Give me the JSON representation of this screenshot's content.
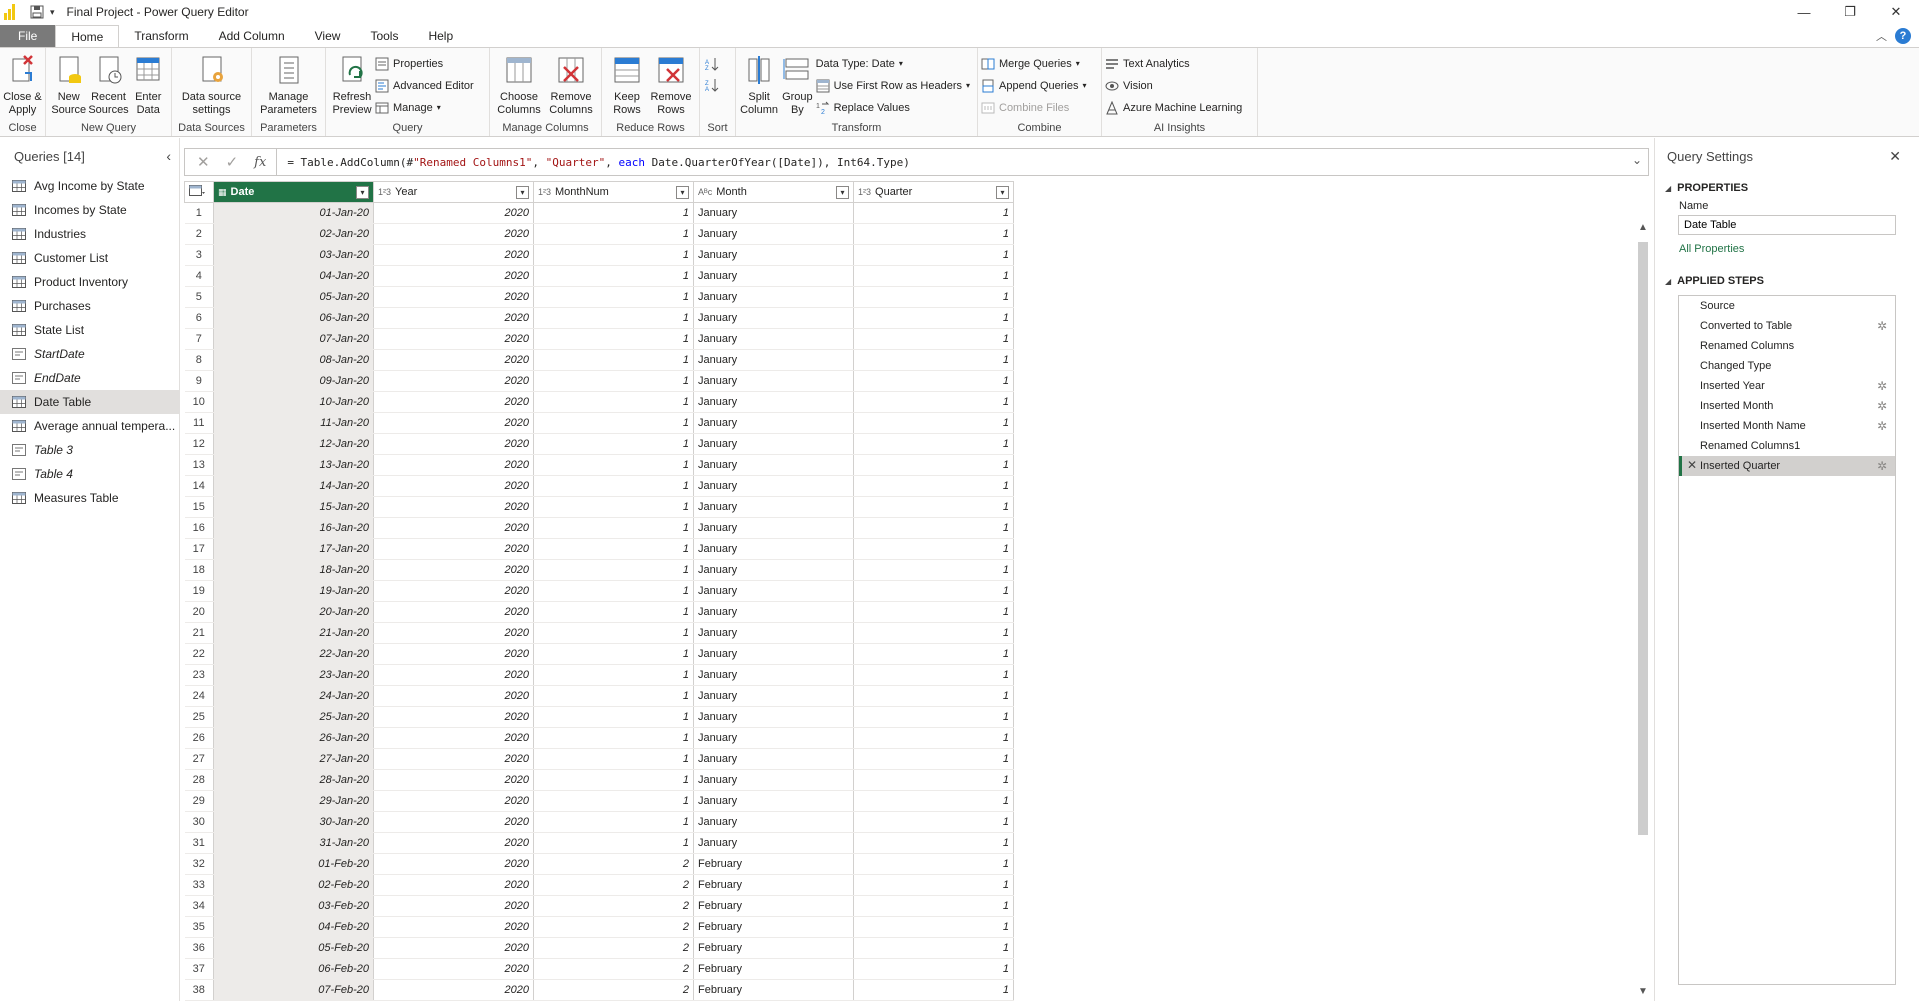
{
  "window": {
    "title": "Final Project - Power Query Editor"
  },
  "tabs": [
    "File",
    "Home",
    "Transform",
    "Add Column",
    "View",
    "Tools",
    "Help"
  ],
  "ribbon": {
    "close": {
      "btn": "Close &\nApply",
      "label": "Close"
    },
    "new_query": {
      "btns": [
        "New\nSource",
        "Recent\nSources",
        "Enter\nData"
      ],
      "label": "New Query"
    },
    "data_sources": {
      "btn": "Data source\nsettings",
      "label": "Data Sources"
    },
    "parameters": {
      "btn": "Manage\nParameters",
      "label": "Parameters"
    },
    "query": {
      "btn": "Refresh\nPreview",
      "small": [
        "Properties",
        "Advanced Editor",
        "Manage"
      ],
      "label": "Query"
    },
    "manage_columns": {
      "btns": [
        "Choose\nColumns",
        "Remove\nColumns"
      ],
      "label": "Manage Columns"
    },
    "reduce_rows": {
      "btns": [
        "Keep\nRows",
        "Remove\nRows"
      ],
      "label": "Reduce Rows"
    },
    "sort": {
      "label": "Sort"
    },
    "transform": {
      "btns": [
        "Split\nColumn",
        "Group\nBy"
      ],
      "small": [
        "Data Type: Date",
        "Use First Row as Headers",
        "Replace Values"
      ],
      "label": "Transform"
    },
    "combine": {
      "small": [
        "Merge Queries",
        "Append Queries",
        "Combine Files"
      ],
      "label": "Combine"
    },
    "ai": {
      "small": [
        "Text Analytics",
        "Vision",
        "Azure Machine Learning"
      ],
      "label": "AI Insights"
    }
  },
  "queries": {
    "title": "Queries [14]",
    "items": [
      {
        "label": "Avg Income by State",
        "type": "table"
      },
      {
        "label": "Incomes by State",
        "type": "table"
      },
      {
        "label": "Industries",
        "type": "table"
      },
      {
        "label": "Customer List",
        "type": "table"
      },
      {
        "label": "Product Inventory",
        "type": "table"
      },
      {
        "label": "Purchases",
        "type": "table"
      },
      {
        "label": "State List",
        "type": "table"
      },
      {
        "label": "StartDate",
        "type": "param"
      },
      {
        "label": "EndDate",
        "type": "param"
      },
      {
        "label": "Date Table",
        "type": "table",
        "selected": true
      },
      {
        "label": "Average annual tempera...",
        "type": "table"
      },
      {
        "label": "Table 3",
        "type": "param"
      },
      {
        "label": "Table 4",
        "type": "param"
      },
      {
        "label": "Measures Table",
        "type": "table"
      }
    ]
  },
  "formula": {
    "text": "= Table.AddColumn(#\"Renamed Columns1\", \"Quarter\", each Date.QuarterOfYear([Date]), Int64.Type)"
  },
  "grid": {
    "columns": [
      {
        "name": "Date",
        "type": "date"
      },
      {
        "name": "Year",
        "type": "123"
      },
      {
        "name": "MonthNum",
        "type": "123"
      },
      {
        "name": "Month",
        "type": "ABC"
      },
      {
        "name": "Quarter",
        "type": "123"
      }
    ],
    "rows": [
      [
        "01-Jan-20",
        "2020",
        "1",
        "January",
        "1"
      ],
      [
        "02-Jan-20",
        "2020",
        "1",
        "January",
        "1"
      ],
      [
        "03-Jan-20",
        "2020",
        "1",
        "January",
        "1"
      ],
      [
        "04-Jan-20",
        "2020",
        "1",
        "January",
        "1"
      ],
      [
        "05-Jan-20",
        "2020",
        "1",
        "January",
        "1"
      ],
      [
        "06-Jan-20",
        "2020",
        "1",
        "January",
        "1"
      ],
      [
        "07-Jan-20",
        "2020",
        "1",
        "January",
        "1"
      ],
      [
        "08-Jan-20",
        "2020",
        "1",
        "January",
        "1"
      ],
      [
        "09-Jan-20",
        "2020",
        "1",
        "January",
        "1"
      ],
      [
        "10-Jan-20",
        "2020",
        "1",
        "January",
        "1"
      ],
      [
        "11-Jan-20",
        "2020",
        "1",
        "January",
        "1"
      ],
      [
        "12-Jan-20",
        "2020",
        "1",
        "January",
        "1"
      ],
      [
        "13-Jan-20",
        "2020",
        "1",
        "January",
        "1"
      ],
      [
        "14-Jan-20",
        "2020",
        "1",
        "January",
        "1"
      ],
      [
        "15-Jan-20",
        "2020",
        "1",
        "January",
        "1"
      ],
      [
        "16-Jan-20",
        "2020",
        "1",
        "January",
        "1"
      ],
      [
        "17-Jan-20",
        "2020",
        "1",
        "January",
        "1"
      ],
      [
        "18-Jan-20",
        "2020",
        "1",
        "January",
        "1"
      ],
      [
        "19-Jan-20",
        "2020",
        "1",
        "January",
        "1"
      ],
      [
        "20-Jan-20",
        "2020",
        "1",
        "January",
        "1"
      ],
      [
        "21-Jan-20",
        "2020",
        "1",
        "January",
        "1"
      ],
      [
        "22-Jan-20",
        "2020",
        "1",
        "January",
        "1"
      ],
      [
        "23-Jan-20",
        "2020",
        "1",
        "January",
        "1"
      ],
      [
        "24-Jan-20",
        "2020",
        "1",
        "January",
        "1"
      ],
      [
        "25-Jan-20",
        "2020",
        "1",
        "January",
        "1"
      ],
      [
        "26-Jan-20",
        "2020",
        "1",
        "January",
        "1"
      ],
      [
        "27-Jan-20",
        "2020",
        "1",
        "January",
        "1"
      ],
      [
        "28-Jan-20",
        "2020",
        "1",
        "January",
        "1"
      ],
      [
        "29-Jan-20",
        "2020",
        "1",
        "January",
        "1"
      ],
      [
        "30-Jan-20",
        "2020",
        "1",
        "January",
        "1"
      ],
      [
        "31-Jan-20",
        "2020",
        "1",
        "January",
        "1"
      ],
      [
        "01-Feb-20",
        "2020",
        "2",
        "February",
        "1"
      ],
      [
        "02-Feb-20",
        "2020",
        "2",
        "February",
        "1"
      ],
      [
        "03-Feb-20",
        "2020",
        "2",
        "February",
        "1"
      ],
      [
        "04-Feb-20",
        "2020",
        "2",
        "February",
        "1"
      ],
      [
        "05-Feb-20",
        "2020",
        "2",
        "February",
        "1"
      ],
      [
        "06-Feb-20",
        "2020",
        "2",
        "February",
        "1"
      ],
      [
        "07-Feb-20",
        "2020",
        "2",
        "February",
        "1"
      ]
    ]
  },
  "settings": {
    "title": "Query Settings",
    "properties": "PROPERTIES",
    "name_label": "Name",
    "name_value": "Date Table",
    "all_properties": "All Properties",
    "applied_steps": "APPLIED STEPS",
    "steps": [
      {
        "label": "Source",
        "gear": false
      },
      {
        "label": "Converted to Table",
        "gear": true
      },
      {
        "label": "Renamed Columns",
        "gear": false
      },
      {
        "label": "Changed Type",
        "gear": false
      },
      {
        "label": "Inserted Year",
        "gear": true
      },
      {
        "label": "Inserted Month",
        "gear": true
      },
      {
        "label": "Inserted Month Name",
        "gear": true
      },
      {
        "label": "Renamed Columns1",
        "gear": false
      },
      {
        "label": "Inserted Quarter",
        "gear": true,
        "selected": true
      }
    ]
  }
}
